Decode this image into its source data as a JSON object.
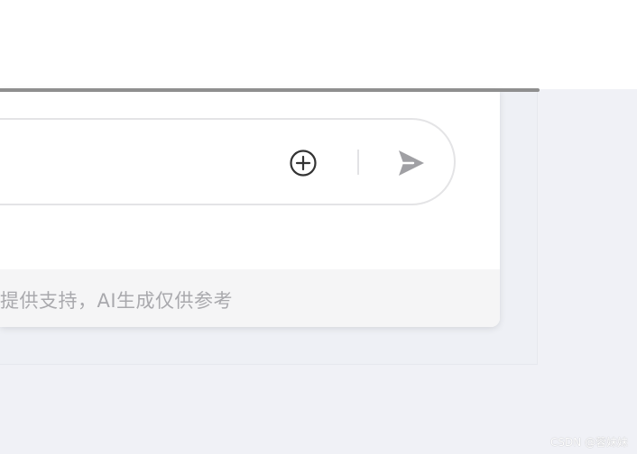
{
  "input": {
    "placeholder": ""
  },
  "actions": {
    "add_icon": "circle-plus-icon",
    "send_icon": "paper-plane-icon"
  },
  "footer": {
    "disclaimer": "提供支持，AI生成仅供参考"
  },
  "watermark": {
    "text": "CSDN @蓉妹妹"
  },
  "colors": {
    "page_bg": "#f0f1f6",
    "card_bg": "#ffffff",
    "footer_bg": "#f5f5f6",
    "footer_text": "#a9a9ad",
    "icon_dark": "#333333",
    "icon_send": "#a0a0a4"
  }
}
